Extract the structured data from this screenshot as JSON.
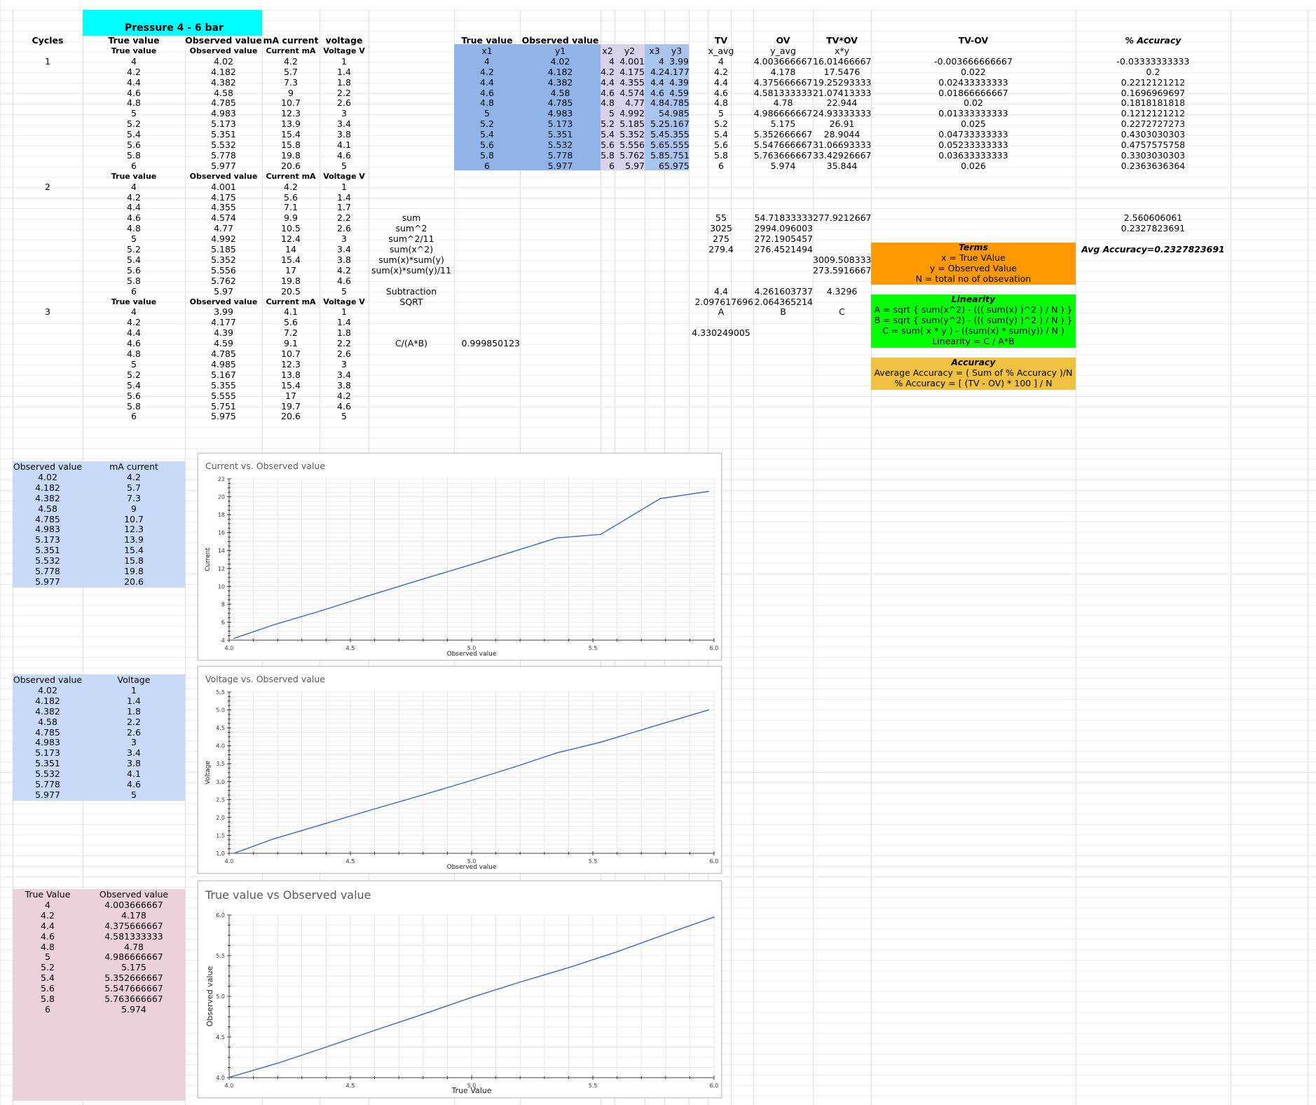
{
  "header": {
    "title": "Pressure 4 - 6 bar"
  },
  "cycles_col": {
    "header": "Cycles",
    "c1": "1",
    "c2": "2",
    "c3": "3"
  },
  "cycle_top_headers": [
    "True value",
    "Observed value",
    "mA current",
    "voltage"
  ],
  "cycle1": {
    "sub": [
      "True value",
      "Observed value",
      "Current mA",
      "Voltage V"
    ],
    "rows": [
      [
        "4",
        "4.02",
        "4.2",
        "1"
      ],
      [
        "4.2",
        "4.182",
        "5.7",
        "1.4"
      ],
      [
        "4.4",
        "4.382",
        "7.3",
        "1.8"
      ],
      [
        "4.6",
        "4.58",
        "9",
        "2.2"
      ],
      [
        "4.8",
        "4.785",
        "10.7",
        "2.6"
      ],
      [
        "5",
        "4.983",
        "12.3",
        "3"
      ],
      [
        "5.2",
        "5.173",
        "13.9",
        "3.4"
      ],
      [
        "5.4",
        "5.351",
        "15.4",
        "3.8"
      ],
      [
        "5.6",
        "5.532",
        "15.8",
        "4.1"
      ],
      [
        "5.8",
        "5.778",
        "19.8",
        "4.6"
      ],
      [
        "6",
        "5.977",
        "20.6",
        "5"
      ]
    ]
  },
  "cycle2": {
    "sub": [
      "True value",
      "Observed value",
      "Current mA",
      "Voltage V"
    ],
    "rows": [
      [
        "4",
        "4.001",
        "4.2",
        "1"
      ],
      [
        "4.2",
        "4.175",
        "5.6",
        "1.4"
      ],
      [
        "4.4",
        "4.355",
        "7.1",
        "1.7"
      ],
      [
        "4.6",
        "4.574",
        "9.9",
        "2.2"
      ],
      [
        "4.8",
        "4.77",
        "10.5",
        "2.6"
      ],
      [
        "5",
        "4.992",
        "12.4",
        "3"
      ],
      [
        "5.2",
        "5.185",
        "14",
        "3.4"
      ],
      [
        "5.4",
        "5.352",
        "15.4",
        "3.8"
      ],
      [
        "5.6",
        "5.556",
        "17",
        "4.2"
      ],
      [
        "5.8",
        "5.762",
        "19.8",
        "4.6"
      ],
      [
        "6",
        "5.97",
        "20.5",
        "5"
      ]
    ]
  },
  "cycle3": {
    "sub": [
      "True value",
      "Observed value",
      "Current mA",
      "Voltage V"
    ],
    "rows": [
      [
        "4",
        "3.99",
        "4.1",
        "1"
      ],
      [
        "4.2",
        "4.177",
        "5.6",
        "1.4"
      ],
      [
        "4.4",
        "4.39",
        "7.2",
        "1.8"
      ],
      [
        "4.6",
        "4.59",
        "9.1",
        "2.2"
      ],
      [
        "4.8",
        "4.785",
        "10.7",
        "2.6"
      ],
      [
        "5",
        "4.985",
        "12.3",
        "3"
      ],
      [
        "5.2",
        "5.167",
        "13.8",
        "3.4"
      ],
      [
        "5.4",
        "5.355",
        "15.4",
        "3.8"
      ],
      [
        "5.6",
        "5.555",
        "17",
        "4.2"
      ],
      [
        "5.8",
        "5.751",
        "19.7",
        "4.6"
      ],
      [
        "6",
        "5.975",
        "20.6",
        "5"
      ]
    ]
  },
  "xy_table": {
    "top": [
      "True value",
      "Observed value"
    ],
    "sub": [
      "x1",
      "y1",
      "x2",
      "y2",
      "x3",
      "y3"
    ],
    "rows": [
      [
        "4",
        "4.02",
        "4",
        "4.001",
        "4",
        "3.99"
      ],
      [
        "4.2",
        "4.182",
        "4.2",
        "4.175",
        "4.2",
        "4.177"
      ],
      [
        "4.4",
        "4.382",
        "4.4",
        "4.355",
        "4.4",
        "4.39"
      ],
      [
        "4.6",
        "4.58",
        "4.6",
        "4.574",
        "4.6",
        "4.59"
      ],
      [
        "4.8",
        "4.785",
        "4.8",
        "4.77",
        "4.8",
        "4.785"
      ],
      [
        "5",
        "4.983",
        "5",
        "4.992",
        "5",
        "4.985"
      ],
      [
        "5.2",
        "5.173",
        "5.2",
        "5.185",
        "5.2",
        "5.167"
      ],
      [
        "5.4",
        "5.351",
        "5.4",
        "5.352",
        "5.4",
        "5.355"
      ],
      [
        "5.6",
        "5.532",
        "5.6",
        "5.556",
        "5.6",
        "5.555"
      ],
      [
        "5.8",
        "5.778",
        "5.8",
        "5.762",
        "5.8",
        "5.751"
      ],
      [
        "6",
        "5.977",
        "6",
        "5.97",
        "6",
        "5.975"
      ]
    ]
  },
  "avg_table": {
    "top": [
      "TV",
      "OV",
      "TV*OV",
      "TV-OV",
      "% Accuracy"
    ],
    "sub": [
      "x_avg",
      "y_avg",
      "x*y"
    ],
    "rows": [
      [
        "4",
        "4.003666667",
        "16.01466667",
        "-0.003666666667",
        "-0.03333333333"
      ],
      [
        "4.2",
        "4.178",
        "17.5476",
        "0.022",
        "0.2"
      ],
      [
        "4.4",
        "4.375666667",
        "19.25293333",
        "0.02433333333",
        "0.2212121212"
      ],
      [
        "4.6",
        "4.581333333",
        "21.07413333",
        "0.01866666667",
        "0.1696969697"
      ],
      [
        "4.8",
        "4.78",
        "22.944",
        "0.02",
        "0.1818181818"
      ],
      [
        "5",
        "4.986666667",
        "24.93333333",
        "0.01333333333",
        "0.1212121212"
      ],
      [
        "5.2",
        "5.175",
        "26.91",
        "0.025",
        "0.2272727273"
      ],
      [
        "5.4",
        "5.352666667",
        "28.9044",
        "0.04733333333",
        "0.4303030303"
      ],
      [
        "5.6",
        "5.547666667",
        "31.06693333",
        "0.05233333333",
        "0.4757575758"
      ],
      [
        "5.8",
        "5.763666667",
        "33.42926667",
        "0.03633333333",
        "0.3303030303"
      ],
      [
        "6",
        "5.974",
        "35.844",
        "0.026",
        "0.2363636364"
      ]
    ]
  },
  "calc": {
    "labels": [
      "sum",
      "sum^2",
      "sum^2/11",
      "sum(x^2)",
      "sum(x)*sum(y)",
      "sum(x)*sum(y)/11"
    ],
    "sum": [
      "55",
      "54.71833333",
      "277.9212667"
    ],
    "sum2": [
      "3025",
      "2994.096003"
    ],
    "sum2_11": [
      "275",
      "272.1905457"
    ],
    "sumx2": [
      "279.4",
      "276.4521494"
    ],
    "sxsy": "3009.508333",
    "sxsy11": "273.5916667",
    "acc_sum": "2.560606061",
    "acc_avg": "0.2327823691",
    "avg_acc_label": "Avg Accuracy=0.2327823691",
    "subtraction_label": "Subtraction",
    "sqrt_label": "SQRT",
    "subtraction": [
      "4.4",
      "4.261603737",
      "4.3296"
    ],
    "sqrt": [
      "2.097617696",
      "2.064365214"
    ],
    "abc": [
      "A",
      "B",
      "C"
    ],
    "ab": "4.330249005",
    "cab_label": "C/(A*B)",
    "cab": "0.999850123"
  },
  "terms_box": {
    "title": "Terms",
    "lines": [
      "x = True VAlue",
      "y = Observed Value",
      "N = total no of obsevation"
    ],
    "color": "#ff9900"
  },
  "linearity_box": {
    "title": "Linearity",
    "lines": [
      "A = sqrt { sum(x^2) - ((( sum(x) )^2 ) / N ) }",
      "B = sqrt { sum(y^2) - ((( sum(y) )^2 ) / N ) }",
      "C = sum( x * y ) - ((sum(x) * sum(y)) / N )",
      "Linearity = C / A*B"
    ],
    "color": "#00ff00"
  },
  "accuracy_box": {
    "title": "Accuracy",
    "lines": [
      "Average Accuracy = ( Sum of % Accuracy )/N",
      "% Accuracy = [ (TV - OV) * 100 ] / N"
    ],
    "color": "#f0c040"
  },
  "summary": {
    "linearity": "Linearity = 0.999850123",
    "accuracy": "Avg Accuracy=0.2327823691"
  },
  "small_tables": {
    "t1": {
      "h": [
        "Observed value",
        "mA current"
      ],
      "rows": [
        [
          "4.02",
          "4.2"
        ],
        [
          "4.182",
          "5.7"
        ],
        [
          "4.382",
          "7.3"
        ],
        [
          "4.58",
          "9"
        ],
        [
          "4.785",
          "10.7"
        ],
        [
          "4.983",
          "12.3"
        ],
        [
          "5.173",
          "13.9"
        ],
        [
          "5.351",
          "15.4"
        ],
        [
          "5.532",
          "15.8"
        ],
        [
          "5.778",
          "19.8"
        ],
        [
          "5.977",
          "20.6"
        ]
      ]
    },
    "t2": {
      "h": [
        "Observed value",
        "Voltage"
      ],
      "rows": [
        [
          "4.02",
          "1"
        ],
        [
          "4.182",
          "1.4"
        ],
        [
          "4.382",
          "1.8"
        ],
        [
          "4.58",
          "2.2"
        ],
        [
          "4.785",
          "2.6"
        ],
        [
          "4.983",
          "3"
        ],
        [
          "5.173",
          "3.4"
        ],
        [
          "5.351",
          "3.8"
        ],
        [
          "5.532",
          "4.1"
        ],
        [
          "5.778",
          "4.6"
        ],
        [
          "5.977",
          "5"
        ]
      ]
    },
    "t3": {
      "h": [
        "True Value",
        "Observed value"
      ],
      "rows": [
        [
          "4",
          "4.003666667"
        ],
        [
          "4.2",
          "4.178"
        ],
        [
          "4.4",
          "4.375666667"
        ],
        [
          "4.6",
          "4.581333333"
        ],
        [
          "4.8",
          "4.78"
        ],
        [
          "5",
          "4.986666667"
        ],
        [
          "5.2",
          "5.175"
        ],
        [
          "5.4",
          "5.352666667"
        ],
        [
          "5.6",
          "5.547666667"
        ],
        [
          "5.8",
          "5.763666667"
        ],
        [
          "6",
          "5.974"
        ]
      ]
    }
  },
  "chart_data": [
    {
      "type": "line",
      "title": "Current vs. Observed value",
      "xlabel": "Observed value",
      "ylabel": "Current",
      "xlim": [
        4,
        6
      ],
      "ylim": [
        4,
        22
      ],
      "xticks": [
        "4.0",
        "4.5",
        "5.0",
        "5.5",
        "6.0"
      ],
      "yticks": [
        "4",
        "6",
        "8",
        "10",
        "12",
        "14",
        "16",
        "18",
        "20",
        "22"
      ],
      "x": [
        4.02,
        4.182,
        4.382,
        4.58,
        4.785,
        4.983,
        5.173,
        5.351,
        5.532,
        5.778,
        5.977
      ],
      "y": [
        4.2,
        5.7,
        7.3,
        9,
        10.7,
        12.3,
        13.9,
        15.4,
        15.8,
        19.8,
        20.6
      ],
      "color": "#4472c4"
    },
    {
      "type": "line",
      "title": "Voltage vs. Observed value",
      "xlabel": "Observed value",
      "ylabel": "Voltage",
      "xlim": [
        4,
        6
      ],
      "ylim": [
        1,
        5.5
      ],
      "xticks": [
        "4.0",
        "4.5",
        "5.0",
        "5.5",
        "6.0"
      ],
      "yticks": [
        "1.0",
        "1.5",
        "2.0",
        "2.5",
        "3.0",
        "3.5",
        "4.0",
        "4.5",
        "5.0",
        "5.5"
      ],
      "x": [
        4.02,
        4.182,
        4.382,
        4.58,
        4.785,
        4.983,
        5.173,
        5.351,
        5.532,
        5.778,
        5.977
      ],
      "y": [
        1,
        1.4,
        1.8,
        2.2,
        2.6,
        3,
        3.4,
        3.8,
        4.1,
        4.6,
        5
      ],
      "color": "#4472c4"
    },
    {
      "type": "line",
      "title": "True value vs Observed value",
      "xlabel": "True Value",
      "ylabel": "Observed value",
      "xlim": [
        4,
        6
      ],
      "ylim": [
        4,
        6
      ],
      "xticks": [
        "4.0",
        "4.5",
        "5.0",
        "5.5",
        "6.0"
      ],
      "yticks": [
        "4.0",
        "4.5",
        "5.0",
        "5.5",
        "6.0"
      ],
      "x": [
        4,
        4.2,
        4.4,
        4.6,
        4.8,
        5,
        5.2,
        5.4,
        5.6,
        5.8,
        6
      ],
      "y": [
        4.003666667,
        4.178,
        4.375666667,
        4.581333333,
        4.78,
        4.986666667,
        5.175,
        5.352666667,
        5.547666667,
        5.763666667,
        5.974
      ],
      "color": "#4472c4"
    }
  ]
}
